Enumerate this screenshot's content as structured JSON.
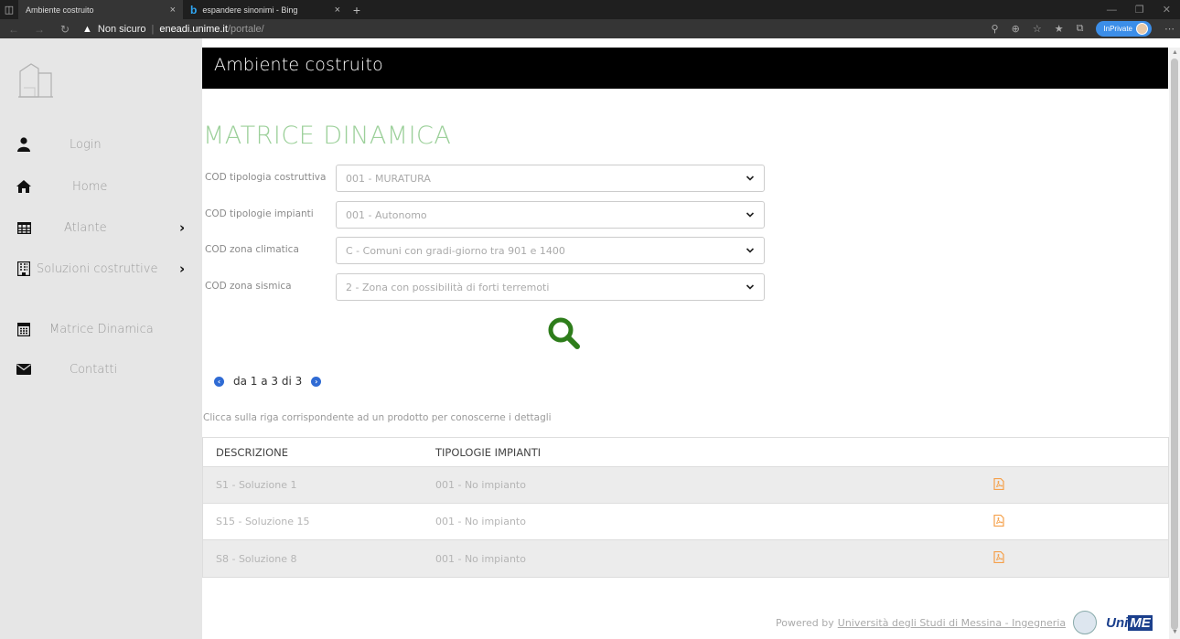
{
  "browser": {
    "tabs": [
      {
        "title": "Ambiente costruito",
        "active": true
      },
      {
        "title": "espandere sinonimi - Bing",
        "active": false
      }
    ],
    "new_tab": "+",
    "security_label": "Non sicuro",
    "url_host": "eneadi.unime.it",
    "url_path": "/portale/",
    "inprivate_label": "InPrivate"
  },
  "sidebar": {
    "items": [
      {
        "label": "Login",
        "icon": "user-icon"
      },
      {
        "label": "Home",
        "icon": "home-icon"
      },
      {
        "label": "Atlante",
        "icon": "table-icon",
        "has_submenu": true
      },
      {
        "label": "Soluzioni costruttive",
        "icon": "building-icon",
        "has_submenu": true
      },
      {
        "label": "Matrice Dinamica",
        "icon": "calculator-icon"
      },
      {
        "label": "Contatti",
        "icon": "envelope-icon"
      }
    ]
  },
  "header": {
    "title": "Ambiente costruito"
  },
  "main": {
    "title": "MATRICE DINAMICA",
    "filters": [
      {
        "label": "COD tipologia costruttiva",
        "value": "001 - MURATURA"
      },
      {
        "label": "COD tipologie impianti",
        "value": "001 - Autonomo"
      },
      {
        "label": "COD zona climatica",
        "value": "C - Comuni con gradi-giorno tra 901 e 1400"
      },
      {
        "label": "COD zona sismica",
        "value": "2 - Zona con possibilità di forti terremoti"
      }
    ],
    "pager_text": "da 1 a 3 di 3",
    "hint": "Clicca sulla riga corrispondente ad un prodotto per conoscerne i dettagli",
    "table": {
      "headers": [
        "DESCRIZIONE",
        "TIPOLOGIE IMPIANTI"
      ],
      "rows": [
        [
          "S1 - Soluzione 1",
          "001 - No impianto"
        ],
        [
          "S15 - Soluzione 15",
          "001 - No impianto"
        ],
        [
          "S8 - Soluzione 8",
          "001 - No impianto"
        ]
      ]
    }
  },
  "footer": {
    "powered_by": "Powered by",
    "link": "Università degli Studi di Messina - Ingegneria",
    "brand_uni": "Uni",
    "brand_me": "ME"
  },
  "colors": {
    "accent_green": "#9cd09a",
    "search_green": "#2e7d1b",
    "pdf_orange": "#f5a04a",
    "pager_blue": "#2f6bd4"
  }
}
